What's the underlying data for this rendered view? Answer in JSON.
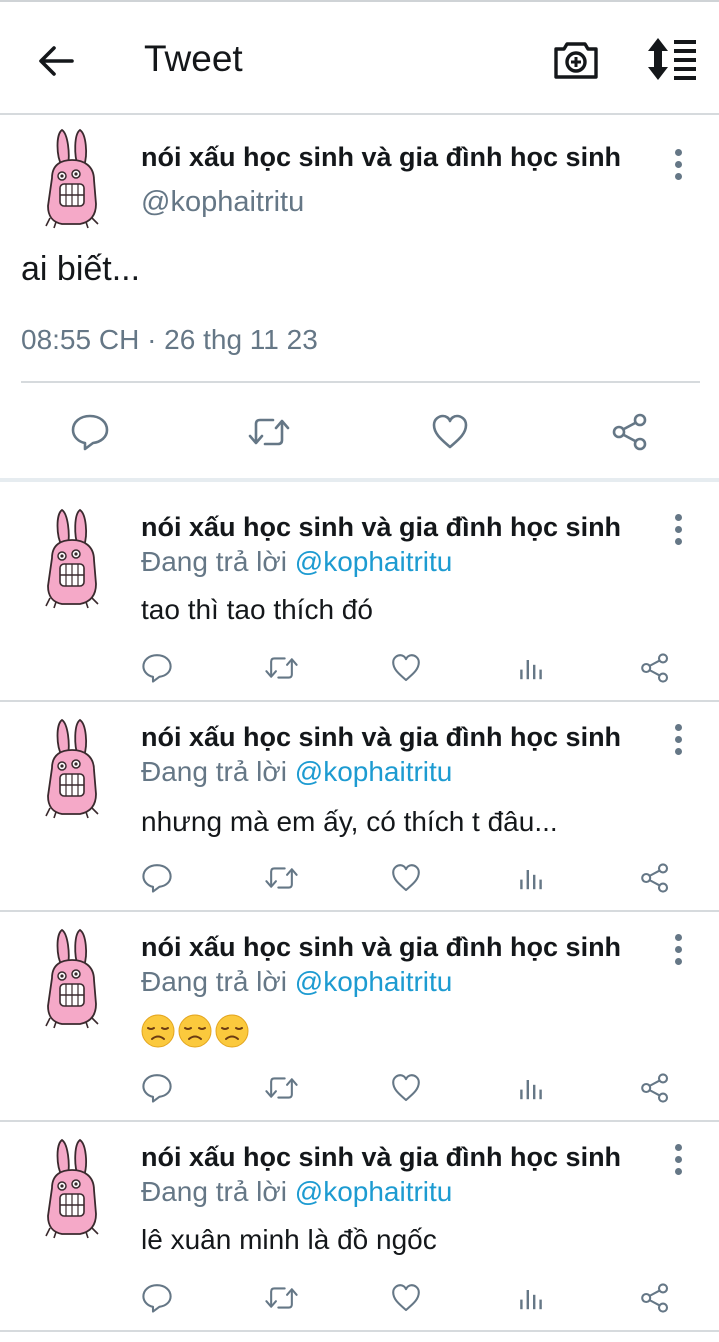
{
  "app_bar": {
    "title": "Tweet",
    "back_icon": "back-arrow-icon",
    "camera_icon": "camera-add-icon",
    "sort_icon": "sort-icon"
  },
  "main_tweet": {
    "name": "nói xấu học sinh và gia đình học sinh",
    "handle": "@kophaitritu",
    "text": "ai biết...",
    "timestamp": "08:55 CH · 26 thg 11 23"
  },
  "replies": [
    {
      "name": "nói xấu học sinh và gia đình học sinh",
      "reply_prefix": "Đang trả lời",
      "mention": "@kophaitritu",
      "text": "tao thì tao thích đó"
    },
    {
      "name": "nói xấu học sinh và gia đình học sinh",
      "reply_prefix": "Đang trả lời",
      "mention": "@kophaitritu",
      "text": "nhưng mà em ấy, có thích t đâu..."
    },
    {
      "name": "nói xấu học sinh và gia đình học sinh",
      "reply_prefix": "Đang trả lời",
      "mention": "@kophaitritu",
      "emoji": "😞",
      "emoji_count": 3
    },
    {
      "name": "nói xấu học sinh và gia đình học sinh",
      "reply_prefix": "Đang trả lời",
      "mention": "@kophaitritu",
      "text": "lê xuân minh là đồ ngốc"
    }
  ],
  "colors": {
    "text": "#14171a",
    "secondary": "#657786",
    "mention": "#1d9bd1",
    "avatar_pink": "#f5a9c8"
  }
}
